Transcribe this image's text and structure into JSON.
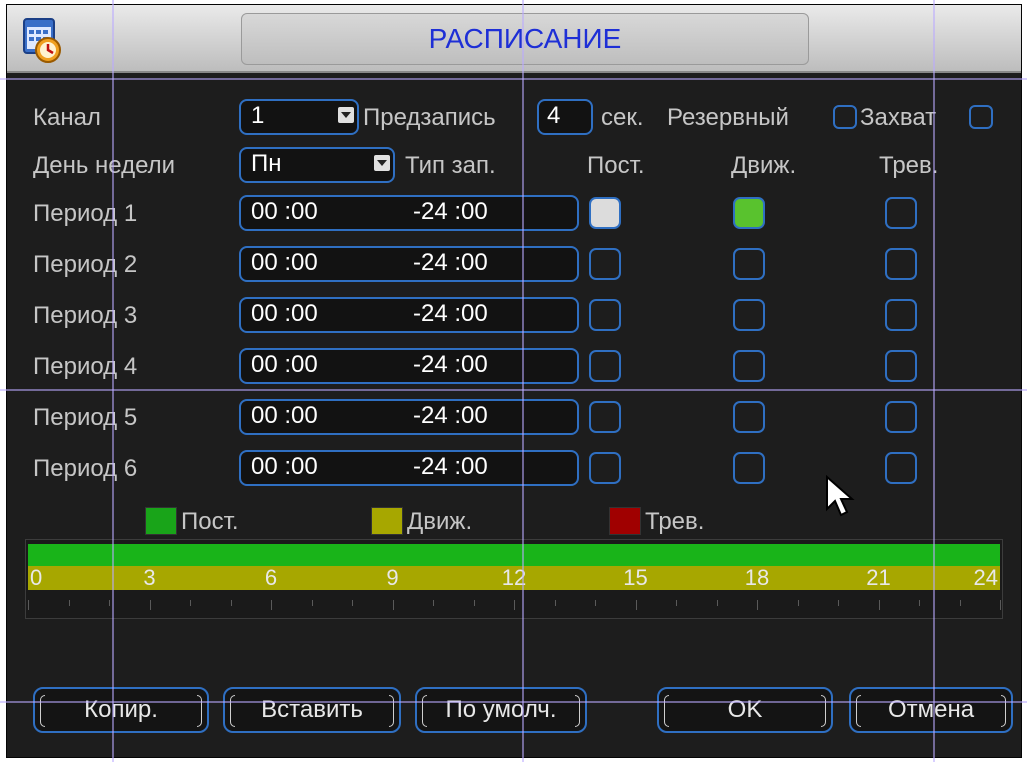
{
  "window": {
    "title": "РАСПИСАНИЕ",
    "icon": "calendar-clock-icon"
  },
  "header_row": {
    "channel_label": "Канал",
    "channel_value": "1",
    "prerecord_label": "Предзапись",
    "prerecord_value": "4",
    "prerecord_unit": "сек.",
    "redundant_label": "Резервный",
    "redundant_checked": false,
    "snapshot_label": "Захват",
    "snapshot_checked": false
  },
  "day_row": {
    "day_label": "День недели",
    "day_value": "Пн",
    "record_type_label": "Тип зап.",
    "col_regular": "Пост.",
    "col_motion": "Движ.",
    "col_alarm": "Трев."
  },
  "periods": [
    {
      "label": "Период 1",
      "start": "00 :00",
      "end": "-24 :00",
      "regular": true,
      "motion": true,
      "alarm": false
    },
    {
      "label": "Период 2",
      "start": "00 :00",
      "end": "-24 :00",
      "regular": false,
      "motion": false,
      "alarm": false
    },
    {
      "label": "Период 3",
      "start": "00 :00",
      "end": "-24 :00",
      "regular": false,
      "motion": false,
      "alarm": false
    },
    {
      "label": "Период 4",
      "start": "00 :00",
      "end": "-24 :00",
      "regular": false,
      "motion": false,
      "alarm": false
    },
    {
      "label": "Период 5",
      "start": "00 :00",
      "end": "-24 :00",
      "regular": false,
      "motion": false,
      "alarm": false
    },
    {
      "label": "Период 6",
      "start": "00 :00",
      "end": "-24 :00",
      "regular": false,
      "motion": false,
      "alarm": false
    }
  ],
  "legend": [
    {
      "label": "Пост.",
      "color": "#19a419"
    },
    {
      "label": "Движ.",
      "color": "#a7a700"
    },
    {
      "label": "Трев.",
      "color": "#a00000"
    }
  ],
  "timeline": {
    "hours": [
      "0",
      "3",
      "6",
      "9",
      "12",
      "15",
      "18",
      "21",
      "24"
    ],
    "regular_range": [
      0,
      24
    ],
    "motion_range": [
      0,
      24
    ]
  },
  "buttons": {
    "copy": "Копир.",
    "paste": "Вставить",
    "default": "По умолч.",
    "ok": "OK",
    "cancel": "Отмена"
  },
  "colors": {
    "accent": "#2f6fc2",
    "title_text": "#1e2fd6",
    "checked_regular": "#dcdcdc",
    "checked_motion": "#59c22e"
  }
}
